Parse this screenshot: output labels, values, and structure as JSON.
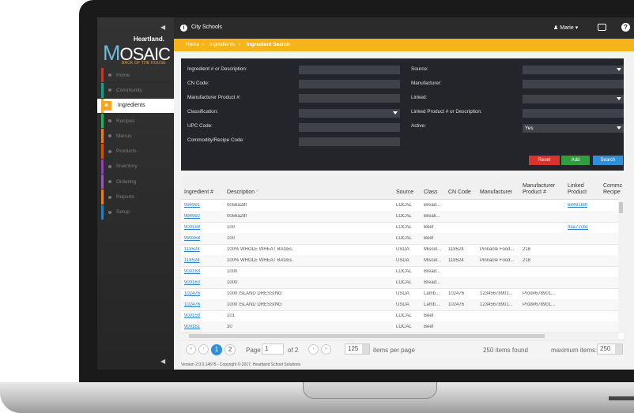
{
  "app": {
    "org": "City Schools",
    "user": "Marie",
    "logo": {
      "brand": "Heartland.",
      "name_initial": "M",
      "name_rest": "OSAIC",
      "tagline": "BACK OF THE HOUSE"
    }
  },
  "breadcrumbs": [
    "Home",
    "Ingredients",
    "Ingredient Search"
  ],
  "sidebar": {
    "items": [
      {
        "label": "Home",
        "color": "#c0392b"
      },
      {
        "label": "Community",
        "color": "#16a085"
      },
      {
        "label": "Ingredients",
        "color": "#f5a623",
        "active": true
      },
      {
        "label": "Recipes",
        "color": "#27ae60"
      },
      {
        "label": "Menus",
        "color": "#e67e22"
      },
      {
        "label": "Products",
        "color": "#d35400"
      },
      {
        "label": "Inventory",
        "color": "#8e44ad"
      },
      {
        "label": "Ordering",
        "color": "#9b59b6"
      },
      {
        "label": "Reports",
        "color": "#e67e22"
      },
      {
        "label": "Setup",
        "color": "#2980b9"
      }
    ]
  },
  "search": {
    "ingredient_label": "Ingredient # or Description:",
    "cn_label": "CN Code:",
    "mfr_product_label": "Manufacturer Product #:",
    "classification_label": "Classification:",
    "upc_label": "UPC Code:",
    "commodity_label": "Commodity/Recipe Code:",
    "source_label": "Source:",
    "manufacturer_label": "Manufacturer:",
    "linked_label": "Linked:",
    "linked_product_label": "Linked Product # or Description:",
    "active_label": "Active:",
    "active_value": "Yes",
    "reset": "Reset",
    "add": "Add",
    "search": "Search"
  },
  "grid": {
    "headers": {
      "ingredient": "Ingredient #",
      "description": "Description",
      "description_sort": "^",
      "source": "Source",
      "class": "Class",
      "cn": "CN Code",
      "manufacturer": "Manufacturer",
      "mfr_product_1": "Manufacturer",
      "mfr_product_2": "Product #",
      "linked_1": "Linked",
      "linked_2": "Product",
      "commodity_1": "Commc",
      "commodity_2": "Recipe"
    },
    "rows": [
      {
        "id": "994991",
        "desc": "0056a28f",
        "source": "LOCAL",
        "class": "Bread...",
        "cn": "",
        "mfr": "",
        "mfrp": "",
        "linked": "6849168f"
      },
      {
        "id": "994992",
        "desc": "0056a28f",
        "source": "LOCAL",
        "class": "Break...",
        "cn": "",
        "mfr": "",
        "mfrp": "",
        "linked": ""
      },
      {
        "id": "900159",
        "desc": "100",
        "source": "LOCAL",
        "class": "Beef",
        "cn": "",
        "mfr": "",
        "mfrp": "",
        "linked": "4aa72cbc"
      },
      {
        "id": "990358",
        "desc": "100",
        "source": "LOCAL",
        "class": "Beef",
        "cn": "",
        "mfr": "",
        "mfrp": "",
        "linked": ""
      },
      {
        "id": "118524",
        "desc": "100% WHOLE WHEAT BAGEL",
        "source": "USDA",
        "class": "Miscel...",
        "cn": "118524",
        "mfr": "Pinnacle Food...",
        "mfrp": "218",
        "linked": ""
      },
      {
        "id": "118524",
        "desc": "100% WHOLE WHEAT BAGEL",
        "source": "USDA",
        "class": "Miscel...",
        "cn": "118524",
        "mfr": "Pinnacle Food...",
        "mfrp": "218",
        "linked": ""
      },
      {
        "id": "900163",
        "desc": "1000",
        "source": "LOCAL",
        "class": "Bread...",
        "cn": "",
        "mfr": "",
        "mfrp": "",
        "linked": ""
      },
      {
        "id": "900163",
        "desc": "1000",
        "source": "LOCAL",
        "class": "Bread...",
        "cn": "",
        "mfr": "",
        "mfrp": "",
        "linked": ""
      },
      {
        "id": "102476",
        "desc": "1000 ISLAND DRESSING",
        "source": "USDA",
        "class": "Lamb...",
        "cn": "102476",
        "mfr": "12345678901...",
        "mfrp": "Prod#678901...",
        "linked": ""
      },
      {
        "id": "102476",
        "desc": "1000 ISLAND DRESSING",
        "source": "USDA",
        "class": "Lamb...",
        "cn": "102476",
        "mfr": "12345678901...",
        "mfrp": "Prod#678901...",
        "linked": ""
      },
      {
        "id": "900159",
        "desc": "101",
        "source": "LOCAL",
        "class": "Beef",
        "cn": "",
        "mfr": "",
        "mfrp": "",
        "linked": ""
      },
      {
        "id": "900161",
        "desc": "30",
        "source": "LOCAL",
        "class": "Beef",
        "cn": "",
        "mfr": "",
        "mfrp": "",
        "linked": ""
      }
    ]
  },
  "pager": {
    "first": "«",
    "prev": "‹",
    "page1": "1",
    "page2": "2",
    "next": "›",
    "last": "»",
    "page_label": "Page",
    "page_value": "1",
    "of_label": "of 2",
    "per_page": "125",
    "per_page_label": "items per page",
    "found": "250 items found",
    "max_label": "maximum items:",
    "max_value": "250"
  },
  "footer": {
    "version": "Version 2.0.0.14575 - Copyright © 2017, Heartland School Solutions"
  },
  "colors": {
    "accent": "#f5b417",
    "reset": "#d9342b",
    "add": "#2e9e3f",
    "search": "#2f8fd8",
    "link": "#2a7fd4"
  }
}
